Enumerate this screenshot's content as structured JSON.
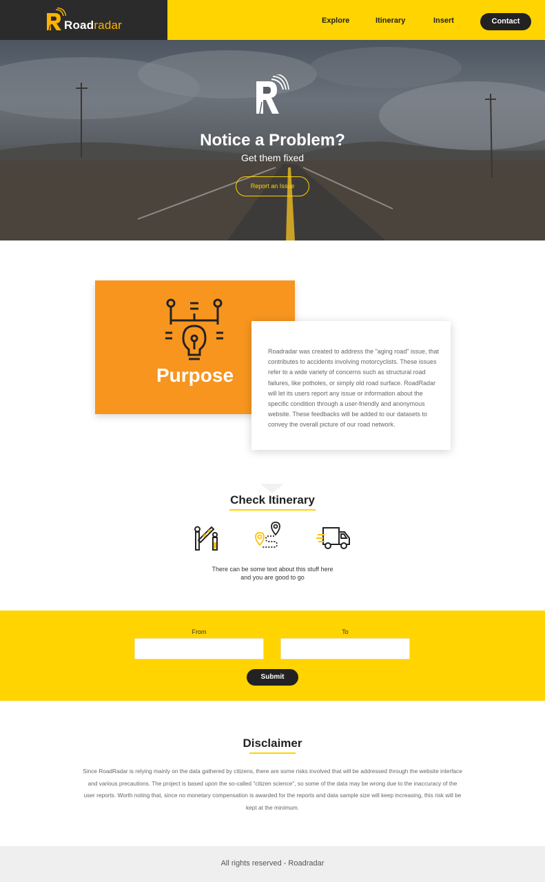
{
  "nav": {
    "logo_road": "Road",
    "logo_radar": "radar",
    "links": [
      "Explore",
      "Itinerary",
      "Insert"
    ],
    "contact_label": "Contact"
  },
  "hero": {
    "title": "Notice a Problem?",
    "subtitle": "Get them fixed",
    "report_label": "Report an Issue"
  },
  "purpose": {
    "title": "Purpose",
    "text": "Roadradar was created to address the \"aging road\" issue, that contributes to accidents involving motorcyclists. These issues refer to a wide variety of concerns such as structural road failures, like potholes, or simply old road surface. RoadRadar will let its users report any issue or information about the specific condition through a user-friendly and anonymous website. These feedbacks will be added to our datasets to convey the overall picture of our road network."
  },
  "itinerary": {
    "title": "Check Itinerary",
    "icons": [
      "road-barrier-icon",
      "route-map-icon",
      "delivery-truck-icon"
    ],
    "text_line1": "There can be some text about this stuff here",
    "text_line2": "and you are good to go"
  },
  "form": {
    "from_label": "From",
    "to_label": "To",
    "from_value": "",
    "to_value": "",
    "submit_label": "Submit"
  },
  "disclaimer": {
    "title": "Disclaimer",
    "text": "Since RoadRadar is relying mainly on the data gathered by citizens, there are some risks involved that will be addressed through the website interface and various precautions. The project is based upon the so-called \"citizen science\", so some of the data may be wrong due to the inaccuracy of the user reports. Worth noting that, since no monetary compensation is awarded for the reports and data sample size will keep increasing, this risk will be kept at the minimum."
  },
  "footer": {
    "text": "All rights reserved - Roadradar"
  },
  "colors": {
    "accent": "#ffd400",
    "orange": "#f7951f",
    "dark": "#2b2b2b"
  }
}
